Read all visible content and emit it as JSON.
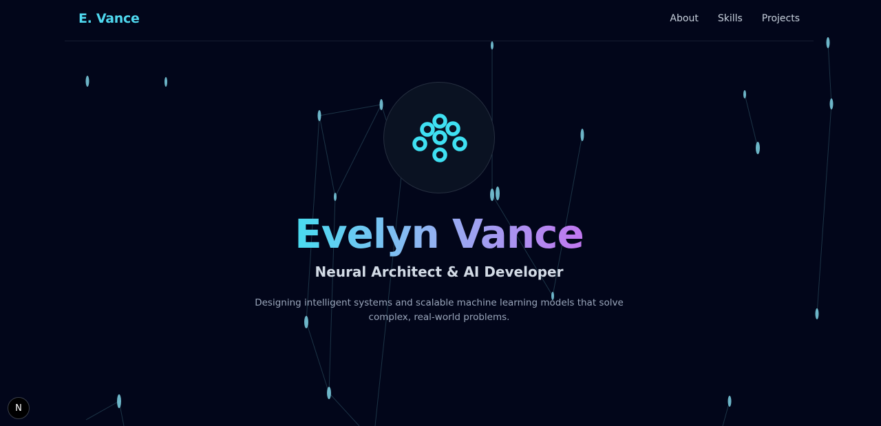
{
  "header": {
    "brand": "E. Vance",
    "nav": [
      {
        "label": "About"
      },
      {
        "label": "Skills"
      },
      {
        "label": "Projects"
      }
    ]
  },
  "hero": {
    "logo_icon": "neural-cluster-icon",
    "name": "Evelyn Vance",
    "role": "Neural Architect & AI Developer",
    "description": "Designing intelligent systems and scalable machine learning models that solve complex, real-world problems."
  },
  "dev_badge": {
    "label": "N",
    "icon": "nextjs-icon"
  },
  "colors": {
    "background": "#02061a",
    "accent_cyan": "#4fd8ef",
    "accent_purple": "#c177f0",
    "node_color": "#7fd4e6"
  }
}
